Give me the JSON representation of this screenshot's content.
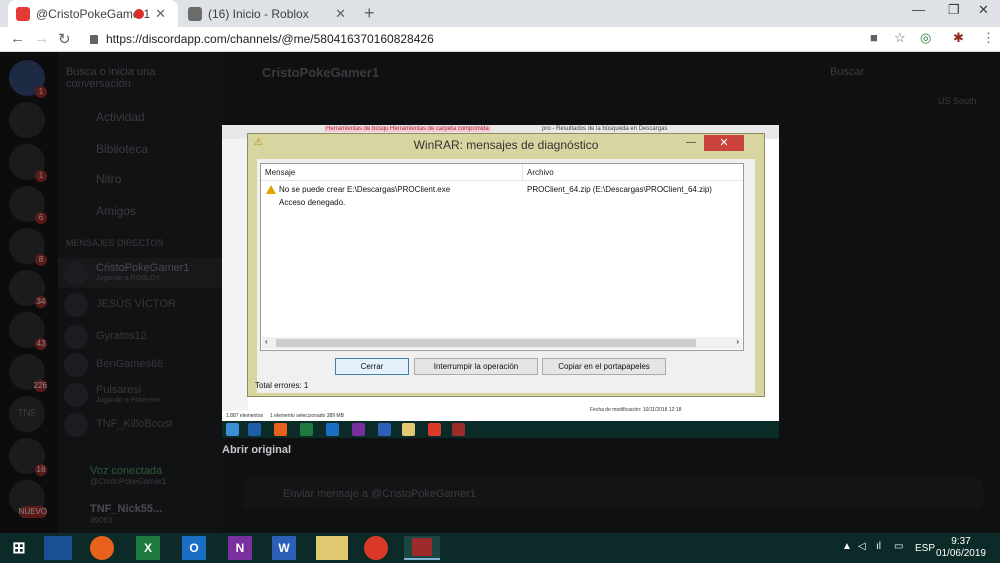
{
  "chrome": {
    "tabs": [
      {
        "title": "@CristoPokeGamer1",
        "active": true
      },
      {
        "title": "(16) Inicio - Roblox",
        "active": false
      }
    ],
    "new_tab_symbol": "+",
    "url": "https://discordapp.com/channels/@me/580416370160828426"
  },
  "discord": {
    "search_placeholder": "Busca o inicia una conversación",
    "header_name": "CristoPokeGamer1",
    "nav": [
      "Actividad",
      "Biblioteca",
      "Nitro",
      "Amigos"
    ],
    "direct_messages_title": "MENSAJES DIRECTOS",
    "dms": [
      {
        "name": "CristoPokeGamer1",
        "status": "Jugando a ROBLOX"
      },
      {
        "name": "JESÚS VÍCTOR",
        "status": ""
      },
      {
        "name": "Gyratos12",
        "status": ""
      },
      {
        "name": "BenGames66",
        "status": ""
      },
      {
        "name": "Pulsaresi",
        "status": "Jugando a Pokémon"
      },
      {
        "name": "TNF_KilloBoost",
        "status": ""
      }
    ],
    "voice_status": "Voz conectada",
    "voice_channel": "@CristoPokeGamer1",
    "user_name": "TNF_Nick55...",
    "user_tag": "#9063",
    "search_label": "Buscar",
    "region": "US South",
    "open_original": "Abrir original",
    "message_placeholder": "Enviar mensaje a @CristoPokeGamer1",
    "server_badges": [
      "1",
      "",
      "1",
      "6",
      "8",
      "34",
      "43",
      "226",
      "",
      "16",
      "NUEVO"
    ]
  },
  "explorer": {
    "ribbon_tags": [
      "Herramientas de búsqueda",
      "Herramientas de carpeta comprimida"
    ],
    "title": "pro - Resultados de la búsqueda en Descargas",
    "status_items": "1.887 elementos",
    "status_selected": "1 elemento seleccionado 389 MB",
    "modified": "Fecha de modificación: 10/11/2018 12:18"
  },
  "dialog": {
    "title": "WinRAR: mensajes de diagnóstico",
    "col_message": "Mensaje",
    "col_file": "Archivo",
    "row_message_line1": "No se puede crear E:\\Descargas\\PROClient.exe",
    "row_message_line2": "Acceso denegado.",
    "row_file": "PROClient_64.zip (E:\\Descargas\\PROClient_64.zip)",
    "buttons": {
      "close": "Cerrar",
      "interrupt": "Interrumpir la operación",
      "copy": "Copiar en el portapapeles"
    },
    "total": "Total errores: 1"
  },
  "taskbar": {
    "language": "ESP",
    "time": "9:37",
    "date": "01/06/2019"
  },
  "colors": {
    "dialog_frame": "#d7d6a0",
    "close_red": "#c9433a",
    "taskbar": "#0c2b28"
  }
}
